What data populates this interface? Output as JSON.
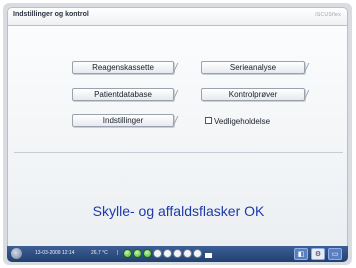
{
  "window": {
    "title": "Indstillinger og kontrol",
    "brand": "ISCUSflex"
  },
  "menu": {
    "reagent": "Reagenskassette",
    "series": "Serieanalyse",
    "patient": "Patientdatabase",
    "control": "Kontrolprøver",
    "settings": "Indstillinger",
    "maintenance": "Vedligeholdelse"
  },
  "status": {
    "message": "Skylle- og affaldsflasker OK"
  },
  "taskbar": {
    "datetime": "13-03-2009 12:14",
    "temperature": "26,7 °C",
    "separator": "|",
    "status_dots": [
      "green",
      "green",
      "green",
      "white",
      "white",
      "white",
      "white",
      "white"
    ],
    "icons": [
      "status-icon",
      "gear-icon",
      "folder-icon"
    ]
  },
  "colors": {
    "status_text": "#1e3aa8",
    "taskbar_bg": "#22406f",
    "dot_green": "#3db03a"
  }
}
